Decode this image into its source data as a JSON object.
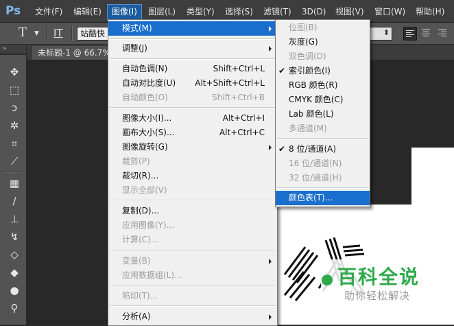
{
  "app": {
    "logo": "Ps"
  },
  "menubar": [
    "文件(F)",
    "编辑(E)",
    "图像(I)",
    "图层(L)",
    "类型(Y)",
    "选择(S)",
    "滤镜(T)",
    "3D(D)",
    "视图(V)",
    "窗口(W)",
    "帮助(H)"
  ],
  "options": {
    "font_family": "站酷快"
  },
  "document": {
    "tab_title": "未标题-1 @ 66.7%"
  },
  "image_menu": {
    "items": [
      {
        "label": "模式(M)",
        "shortcut": "",
        "submenu": true,
        "enabled": true,
        "highlighted": true
      },
      {
        "label": "调整(J)",
        "shortcut": "",
        "submenu": true,
        "enabled": true
      },
      {
        "label": "自动色调(N)",
        "shortcut": "Shift+Ctrl+L",
        "enabled": true
      },
      {
        "label": "自动对比度(U)",
        "shortcut": "Alt+Shift+Ctrl+L",
        "enabled": true
      },
      {
        "label": "自动颜色(O)",
        "shortcut": "Shift+Ctrl+B",
        "enabled": false
      },
      {
        "label": "图像大小(I)...",
        "shortcut": "Alt+Ctrl+I",
        "enabled": true
      },
      {
        "label": "画布大小(S)...",
        "shortcut": "Alt+Ctrl+C",
        "enabled": true
      },
      {
        "label": "图像旋转(G)",
        "shortcut": "",
        "submenu": true,
        "enabled": true
      },
      {
        "label": "裁剪(P)",
        "shortcut": "",
        "enabled": false
      },
      {
        "label": "裁切(R)...",
        "shortcut": "",
        "enabled": true
      },
      {
        "label": "显示全部(V)",
        "shortcut": "",
        "enabled": false
      },
      {
        "label": "复制(D)...",
        "shortcut": "",
        "enabled": true
      },
      {
        "label": "应用图像(Y)...",
        "shortcut": "",
        "enabled": false
      },
      {
        "label": "计算(C)...",
        "shortcut": "",
        "enabled": false
      },
      {
        "label": "变量(B)",
        "shortcut": "",
        "submenu": true,
        "enabled": false
      },
      {
        "label": "应用数据组(L)...",
        "shortcut": "",
        "enabled": false
      },
      {
        "label": "陷印(T)...",
        "shortcut": "",
        "enabled": false
      },
      {
        "label": "分析(A)",
        "shortcut": "",
        "submenu": true,
        "enabled": true
      }
    ]
  },
  "mode_submenu": {
    "items": [
      {
        "label": "位图(B)",
        "enabled": false,
        "checked": false
      },
      {
        "label": "灰度(G)",
        "enabled": true,
        "checked": false
      },
      {
        "label": "双色调(D)",
        "enabled": false,
        "checked": false
      },
      {
        "label": "索引颜色(I)",
        "enabled": true,
        "checked": true
      },
      {
        "label": "RGB 颜色(R)",
        "enabled": true,
        "checked": false
      },
      {
        "label": "CMYK 颜色(C)",
        "enabled": true,
        "checked": false
      },
      {
        "label": "Lab 颜色(L)",
        "enabled": true,
        "checked": false
      },
      {
        "label": "多通道(M)",
        "enabled": false,
        "checked": false
      },
      {
        "label": "8 位/通道(A)",
        "enabled": true,
        "checked": true
      },
      {
        "label": "16 位/通道(N)",
        "enabled": false,
        "checked": false
      },
      {
        "label": "32 位/通道(H)",
        "enabled": false,
        "checked": false
      },
      {
        "label": "颜色表(T)...",
        "enabled": true,
        "checked": false,
        "highlighted": true
      }
    ],
    "check_mark": "✔"
  },
  "watermark": {
    "title": "百科全说",
    "subtitle": "助你轻松解决"
  },
  "colors": {
    "highlight": "#1a6fce",
    "menu_bg": "#f0f0f0",
    "disabled": "#9c9c9c",
    "watermark_green": "#2eaa4a"
  }
}
